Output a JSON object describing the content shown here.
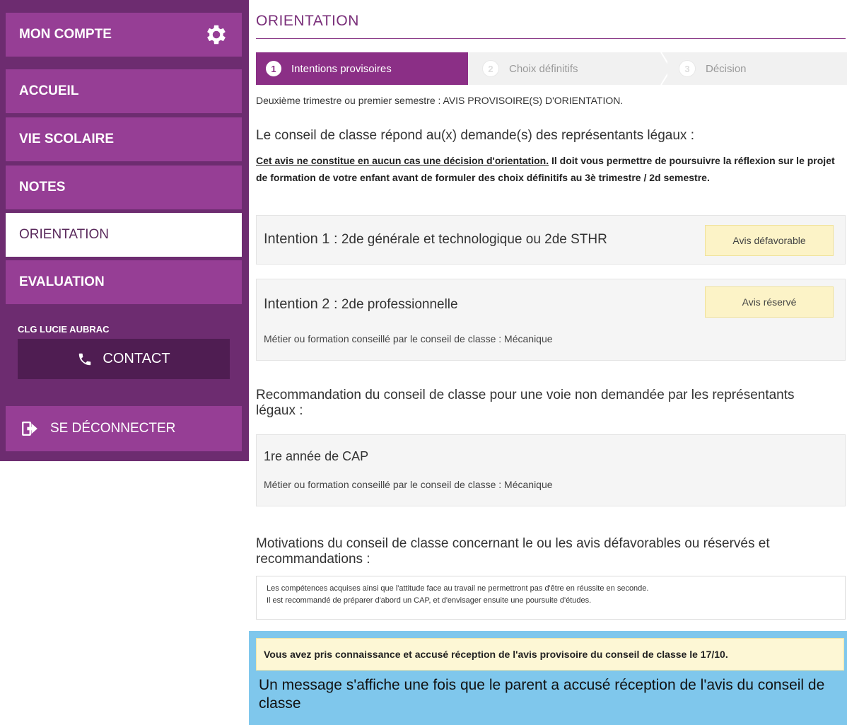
{
  "sidebar": {
    "account": "MON COMPTE",
    "items": [
      {
        "label": "ACCUEIL"
      },
      {
        "label": "VIE SCOLAIRE"
      },
      {
        "label": "NOTES"
      },
      {
        "label": "ORIENTATION"
      },
      {
        "label": "EVALUATION"
      }
    ],
    "active": "ORIENTATION",
    "school": "CLG LUCIE AUBRAC",
    "contact": "CONTACT",
    "logout": "SE DÉCONNECTER"
  },
  "page": {
    "title": "ORIENTATION"
  },
  "stepper": [
    {
      "num": "1",
      "label": "Intentions provisoires",
      "state": "active"
    },
    {
      "num": "2",
      "label": "Choix définitifs",
      "state": "inactive"
    },
    {
      "num": "3",
      "label": "Décision",
      "state": "inactive"
    }
  ],
  "content": {
    "period": "Deuxième trimestre ou premier semestre : AVIS PROVISOIRE(S) D'ORIENTATION.",
    "conseil_heading": "Le conseil de classe répond au(x) demande(s) des représentants légaux :",
    "warning_underlined": "Cet avis ne constitue en aucun cas une décision d'orientation.",
    "warning_rest": " Il doit vous permettre de poursuivre la réflexion sur le projet de formation de votre enfant avant de formuler des choix définitifs au 3è trimestre / 2d semestre.",
    "intentions": [
      {
        "label": "Intention 1 :",
        "value": "2de générale et technologique ou 2de STHR",
        "avis": "Avis défavorable",
        "note": ""
      },
      {
        "label": "Intention 2 :",
        "value": "2de professionnelle",
        "avis": "Avis réservé",
        "note": "Métier ou formation conseillé par le conseil de classe : Mécanique"
      }
    ],
    "reco_heading": "Recommandation du conseil de classe pour une voie non demandée par les représentants légaux :",
    "reco_title": "1re année de CAP",
    "reco_note": "Métier ou formation conseillé par le conseil de classe : Mécanique",
    "motiv_heading": "Motivations du conseil de classe concernant le ou les avis défavorables ou réservés et recommandations :",
    "motiv_line1": "Les compétences acquises ainsi que l'attitude face au travail ne permettront pas d'être en réussite en seconde.",
    "motiv_line2": "Il est recommandé de préparer d'abord un CAP, et d'envisager ensuite une poursuite d'études.",
    "ack": "Vous avez pris connaissance et accusé réception de l'avis provisoire du conseil de classe le 17/10.",
    "callout": "Un message s'affiche une fois que le parent a accusé réception de l'avis du conseil de classe"
  },
  "colors": {
    "sidebar_dark": "#6d2c70",
    "sidebar_item": "#963e95",
    "accent": "#8b2f86",
    "avis_bg": "#fcf3c7",
    "callout_bg": "#7fc7ec"
  }
}
